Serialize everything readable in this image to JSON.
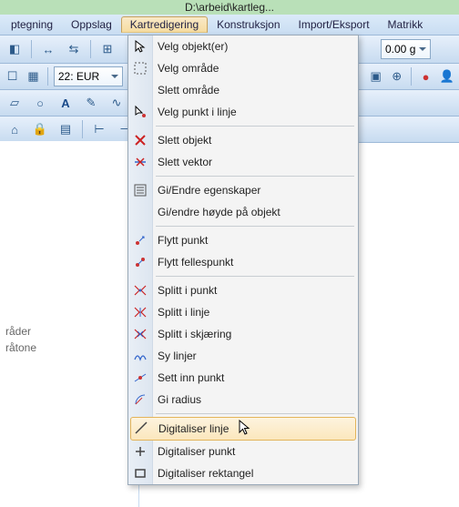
{
  "title_strip": "D:\\arbeid\\kartleg...",
  "menubar": {
    "items": [
      "ptegning",
      "Oppslag",
      "Kartredigering",
      "Konstruksjon",
      "Import/Eksport",
      "Matrikk"
    ],
    "open_index": 2
  },
  "toolbar_row1": {
    "value_field": "0.00 g"
  },
  "toolbar_row2": {
    "layer_dd": "22: EUR"
  },
  "left_panel": {
    "line1": "råder",
    "line2": "råtone"
  },
  "dropdown": {
    "groups": [
      [
        {
          "icon": "cursor-icon",
          "label": "Velg objekt(er)"
        },
        {
          "icon": "marquee-icon",
          "label": "Velg område"
        },
        {
          "icon": "",
          "label": "Slett område"
        },
        {
          "icon": "point-cursor-icon",
          "label": "Velg punkt i linje"
        }
      ],
      [
        {
          "icon": "delete-x-icon",
          "label": "Slett objekt"
        },
        {
          "icon": "delete-vector-icon",
          "label": "Slett vektor"
        }
      ],
      [
        {
          "icon": "properties-icon",
          "label": "Gi/Endre egenskaper"
        },
        {
          "icon": "",
          "label": "Gi/endre høyde på objekt"
        }
      ],
      [
        {
          "icon": "move-point-icon",
          "label": "Flytt punkt"
        },
        {
          "icon": "move-shared-point-icon",
          "label": "Flytt fellespunkt"
        }
      ],
      [
        {
          "icon": "split-point-icon",
          "label": "Splitt i punkt"
        },
        {
          "icon": "split-line-icon",
          "label": "Splitt i linje"
        },
        {
          "icon": "split-intersection-icon",
          "label": "Splitt i skjæring"
        },
        {
          "icon": "sew-lines-icon",
          "label": "Sy linjer"
        },
        {
          "icon": "insert-point-icon",
          "label": "Sett inn punkt"
        },
        {
          "icon": "radius-icon",
          "label": "Gi radius"
        }
      ],
      [
        {
          "icon": "line-icon",
          "label": "Digitaliser linje",
          "highlighted": true
        },
        {
          "icon": "plus-icon",
          "label": "Digitaliser punkt"
        },
        {
          "icon": "rectangle-icon",
          "label": "Digitaliser rektangel"
        }
      ]
    ]
  }
}
